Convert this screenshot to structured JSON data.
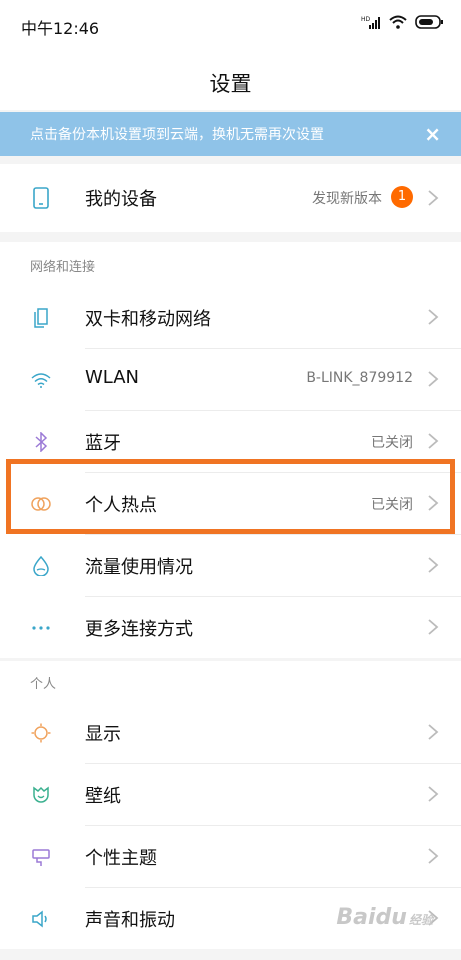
{
  "status_bar": {
    "time": "中午12:46",
    "network": "HD"
  },
  "header": {
    "title": "设置"
  },
  "banner": {
    "text": "点击备份本机设置项到云端，换机无需再次设置",
    "close": "×"
  },
  "my_device": {
    "label": "我的设备",
    "value": "发现新版本",
    "badge": "1"
  },
  "section_network": {
    "title": "网络和连接",
    "items": [
      {
        "label": "双卡和移动网络",
        "value": "",
        "icon": "dual-sim-icon"
      },
      {
        "label": "WLAN",
        "value": "B-LINK_879912",
        "icon": "wifi-icon"
      },
      {
        "label": "蓝牙",
        "value": "已关闭",
        "icon": "bluetooth-icon"
      },
      {
        "label": "个人热点",
        "value": "已关闭",
        "icon": "hotspot-icon"
      },
      {
        "label": "流量使用情况",
        "value": "",
        "icon": "data-usage-icon"
      },
      {
        "label": "更多连接方式",
        "value": "",
        "icon": "more-icon"
      }
    ]
  },
  "section_personal": {
    "title": "个人",
    "items": [
      {
        "label": "显示",
        "icon": "display-icon"
      },
      {
        "label": "壁纸",
        "icon": "wallpaper-icon"
      },
      {
        "label": "个性主题",
        "icon": "theme-icon"
      },
      {
        "label": "声音和振动",
        "icon": "sound-icon"
      }
    ]
  },
  "watermark": {
    "brand": "Baidu",
    "suffix": "经验"
  },
  "colors": {
    "accent": "#f07423",
    "banner": "#8fc3e8",
    "badge": "#ff6a00",
    "icon_blue": "#3aa6c9"
  }
}
